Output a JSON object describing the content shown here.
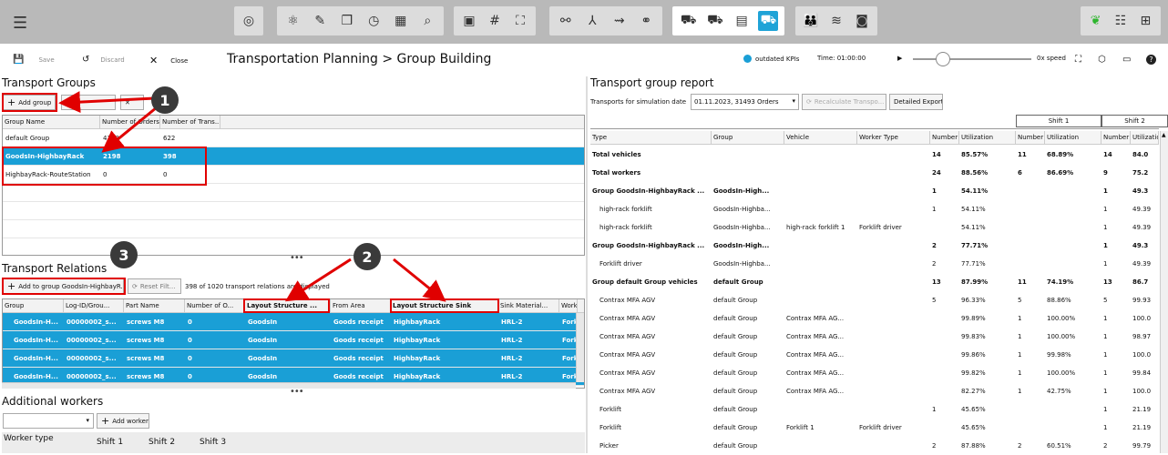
{
  "topbar": {
    "menu_icon": "hamburger-icon",
    "right_icons": [
      "leaf-icon",
      "sliders-icon",
      "network-icon"
    ]
  },
  "actions": {
    "save": "Save",
    "discard": "Discard",
    "close": "Close"
  },
  "breadcrumb": {
    "part1": "Transportation Planning",
    "sep": ">",
    "part2": "Group Building"
  },
  "status": {
    "kpi": "outdated KPIs",
    "time": "Time: 01:00:00",
    "speed": "0x speed"
  },
  "groups": {
    "title": "Transport Groups",
    "add_button": "Add group",
    "columns": [
      "Group Name",
      "Number of Orders",
      "Number of Trans..."
    ],
    "rows": [
      [
        "default Group",
        "4138",
        "622"
      ],
      [
        "GoodsIn-HighbayRack",
        "2198",
        "398"
      ],
      [
        "HighbayRack-RouteStation",
        "0",
        "0"
      ]
    ]
  },
  "relations": {
    "title": "Transport Relations",
    "add_button": "Add to group GoodsIn-HighbayR...",
    "reset_button": "Reset Filt...",
    "count_text": "398 of 1020 transport relations are displayed",
    "columns": [
      "Group",
      "Log-ID/Grou...",
      "Part Name",
      "Number of O...",
      "Layout Structure ...",
      "From Area",
      "Layout Structure Sink",
      "Sink Material...",
      "Worke"
    ],
    "rows": [
      [
        "GoodsIn-H...",
        "00000002_s...",
        "screws M8",
        "0",
        "GoodsIn",
        "Goods receipt",
        "HighbayRack",
        "HRL-2",
        "Forkl"
      ],
      [
        "GoodsIn-H...",
        "00000002_s...",
        "screws M8",
        "0",
        "GoodsIn",
        "Goods receipt",
        "HighbayRack",
        "HRL-2",
        "Forkl"
      ],
      [
        "GoodsIn-H...",
        "00000002_s...",
        "screws M8",
        "0",
        "GoodsIn",
        "Goods receipt",
        "HighbayRack",
        "HRL-2",
        "Forkl"
      ],
      [
        "GoodsIn-H...",
        "00000002_s...",
        "screws M8",
        "0",
        "GoodsIn",
        "Goods receipt",
        "HighbayRack",
        "HRL-2",
        "Forkl"
      ]
    ]
  },
  "workers": {
    "title": "Additional workers",
    "add_button": "Add worker",
    "header": [
      "Worker type",
      "Shift 1",
      "Shift 2",
      "Shift 3"
    ]
  },
  "report": {
    "title": "Transport group report",
    "date_label": "Transports for simulation date",
    "date_value": "01.11.2023, 31493 Orders",
    "recalc": "Recalculate Transpo...",
    "export": "Detailed Export",
    "shift1": "Shift 1",
    "shift2": "Shift 2",
    "columns": [
      "Type",
      "Group",
      "Vehicle",
      "Worker Type",
      "Number",
      "Utilization",
      "Number",
      "Utilization",
      "Number",
      "Utilizatio"
    ],
    "rows": [
      {
        "bold": true,
        "c": [
          "Total vehicles",
          "",
          "",
          "",
          "14",
          "85.57%",
          "11",
          "68.89%",
          "14",
          "84.0"
        ]
      },
      {
        "bold": true,
        "c": [
          "Total workers",
          "",
          "",
          "",
          "24",
          "88.56%",
          "6",
          "86.69%",
          "9",
          "75.2"
        ]
      },
      {
        "bold": true,
        "c": [
          "Group GoodsIn-HighbayRack ...",
          "GoodsIn-High...",
          "",
          "",
          "1",
          "54.11%",
          "",
          "",
          "1",
          "49.3"
        ]
      },
      {
        "bold": false,
        "c": [
          "high-rack forklift",
          "GoodsIn-Highba...",
          "",
          "",
          "1",
          "54.11%",
          "",
          "",
          "1",
          "49.39"
        ]
      },
      {
        "bold": false,
        "c": [
          "high-rack forklift",
          "GoodsIn-Highba...",
          "high-rack forklift 1",
          "Forklift driver",
          "",
          "54.11%",
          "",
          "",
          "1",
          "49.39"
        ]
      },
      {
        "bold": true,
        "c": [
          "Group GoodsIn-HighbayRack ...",
          "GoodsIn-High...",
          "",
          "",
          "2",
          "77.71%",
          "",
          "",
          "1",
          "49.3"
        ]
      },
      {
        "bold": false,
        "c": [
          "Forklift driver",
          "GoodsIn-Highba...",
          "",
          "",
          "2",
          "77.71%",
          "",
          "",
          "1",
          "49.39"
        ]
      },
      {
        "bold": true,
        "c": [
          "Group default Group vehicles",
          "default Group",
          "",
          "",
          "13",
          "87.99%",
          "11",
          "74.19%",
          "13",
          "86.7"
        ]
      },
      {
        "bold": false,
        "c": [
          "Contrax MFA AGV",
          "default Group",
          "",
          "",
          "5",
          "96.33%",
          "5",
          "88.86%",
          "5",
          "99.93"
        ]
      },
      {
        "bold": false,
        "c": [
          "Contrax MFA AGV",
          "default Group",
          "Contrax MFA AG...",
          "",
          "",
          "99.89%",
          "1",
          "100.00%",
          "1",
          "100.0"
        ]
      },
      {
        "bold": false,
        "c": [
          "Contrax MFA AGV",
          "default Group",
          "Contrax MFA AG...",
          "",
          "",
          "99.83%",
          "1",
          "100.00%",
          "1",
          "98.97"
        ]
      },
      {
        "bold": false,
        "c": [
          "Contrax MFA AGV",
          "default Group",
          "Contrax MFA AG...",
          "",
          "",
          "99.86%",
          "1",
          "99.98%",
          "1",
          "100.0"
        ]
      },
      {
        "bold": false,
        "c": [
          "Contrax MFA AGV",
          "default Group",
          "Contrax MFA AG...",
          "",
          "",
          "99.82%",
          "1",
          "100.00%",
          "1",
          "99.84"
        ]
      },
      {
        "bold": false,
        "c": [
          "Contrax MFA AGV",
          "default Group",
          "Contrax MFA AG...",
          "",
          "",
          "82.27%",
          "1",
          "42.75%",
          "1",
          "100.0"
        ]
      },
      {
        "bold": false,
        "c": [
          "Forklift",
          "default Group",
          "",
          "",
          "1",
          "45.65%",
          "",
          "",
          "1",
          "21.19"
        ]
      },
      {
        "bold": false,
        "c": [
          "Forklift",
          "default Group",
          "Forklift 1",
          "Forklift driver",
          "",
          "45.65%",
          "",
          "",
          "1",
          "21.19"
        ]
      },
      {
        "bold": false,
        "c": [
          "Picker",
          "default Group",
          "",
          "",
          "2",
          "87.88%",
          "2",
          "60.51%",
          "2",
          "99.79"
        ]
      }
    ]
  },
  "annotations": [
    "1",
    "2",
    "3"
  ],
  "colors": {
    "selection": "#1a9fd6",
    "highlight": "#e00000",
    "topbar": "#b9b9b9"
  }
}
